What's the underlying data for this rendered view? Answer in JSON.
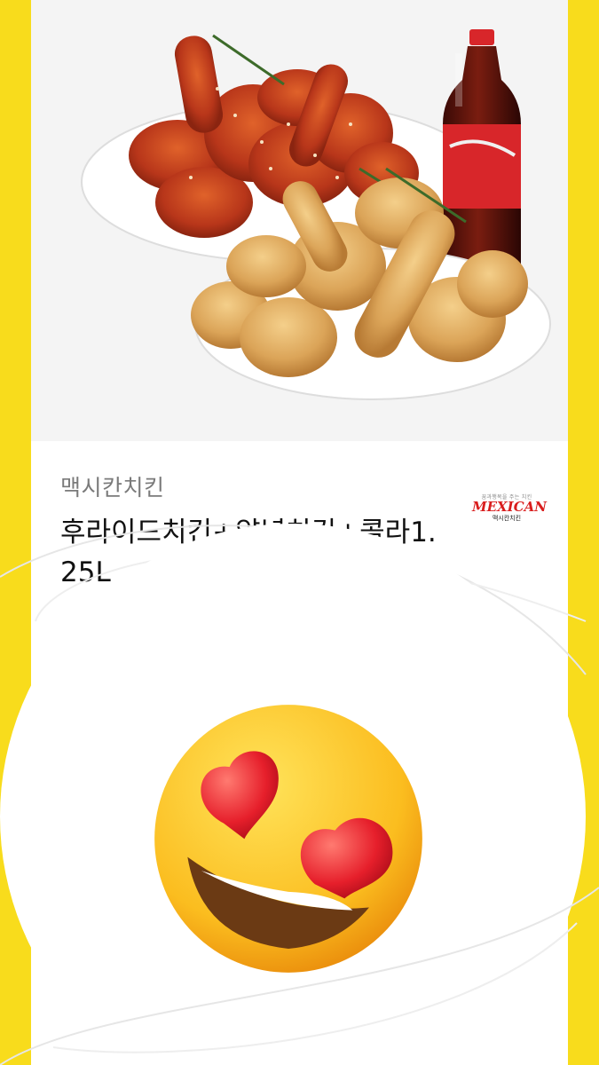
{
  "product": {
    "brand": "맥시칸치킨",
    "title": "후라이드치킨+양념치킨+콜라1.25L",
    "image_alt": "fried chicken, seasoned chicken and cola bottle"
  },
  "brand_logo": {
    "tagline": "꿈과행복을 주는 치킨",
    "name": "MEXICAN",
    "sub": "맥시칸치킨"
  },
  "overlay": {
    "emoji": "smiling-face-with-heart-eyes-icon"
  },
  "colors": {
    "background": "#f8dc1c",
    "card": "#ffffff",
    "logo_red": "#d91d1d"
  }
}
